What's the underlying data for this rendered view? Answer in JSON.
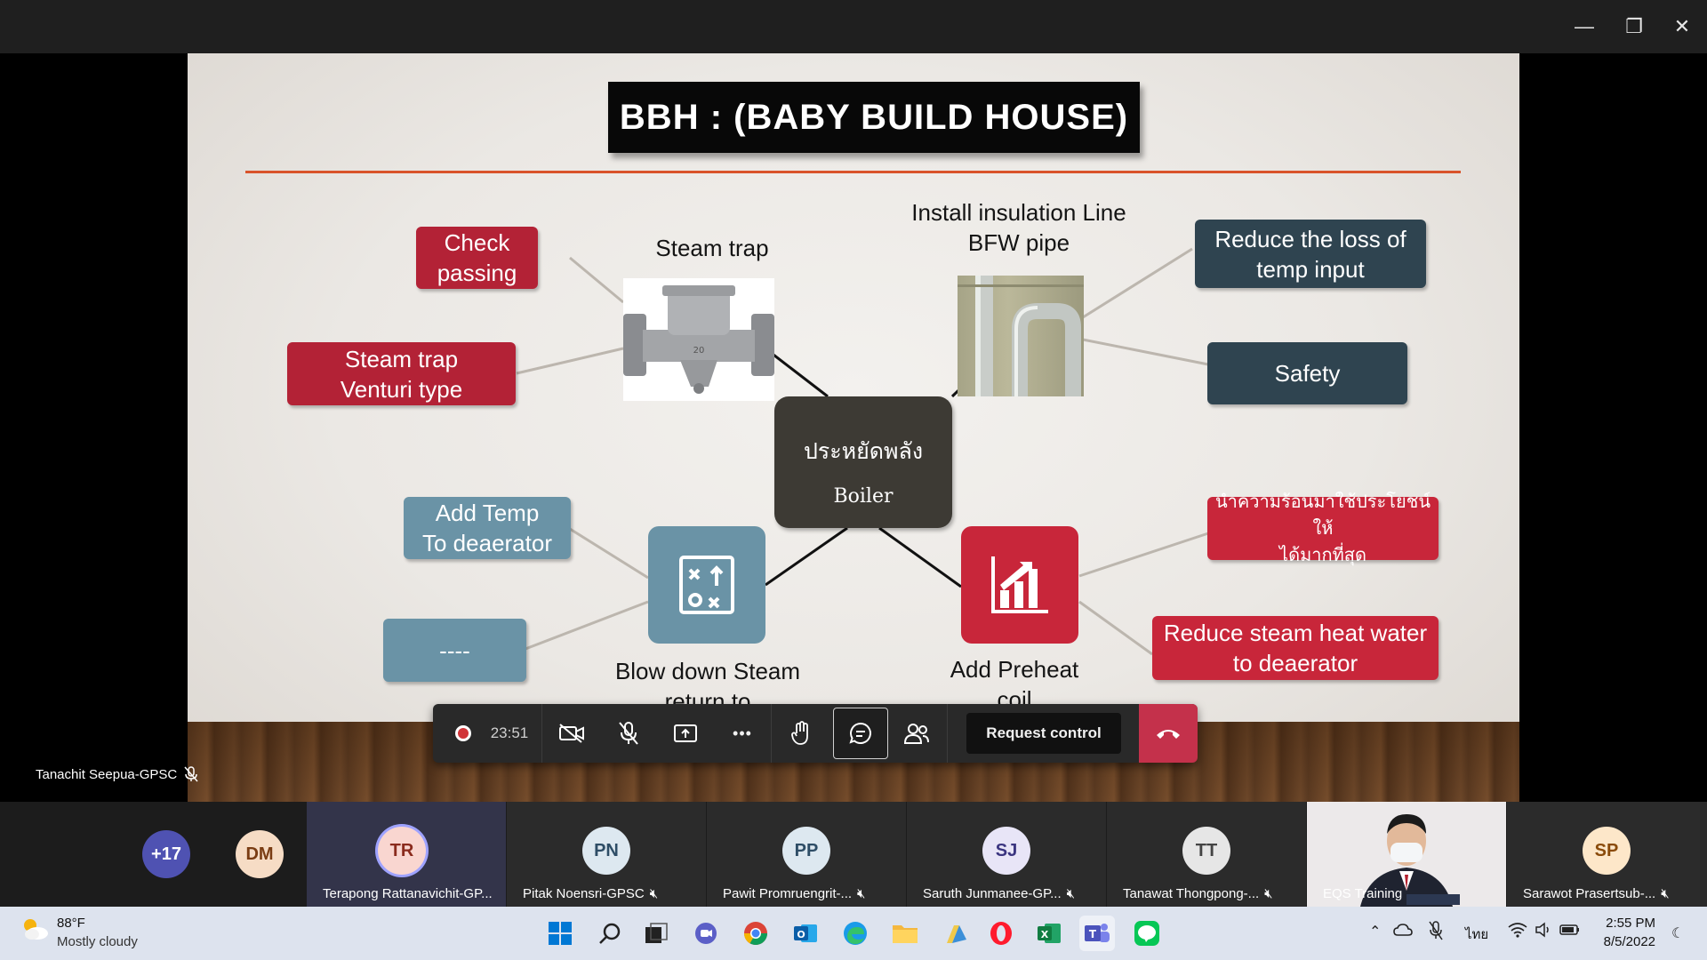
{
  "window": {
    "minimize": "—",
    "restore": "❐",
    "close": "✕"
  },
  "slide": {
    "title": "BBH : (BABY BUILD HOUSE)",
    "center": {
      "line1": "ประหยัดพลัง",
      "line2": "Boiler"
    },
    "top_left_label": "Steam trap",
    "top_right_label": "Install insulation Line\nBFW pipe",
    "bottom_left_label": "Blow down Steam\nreturn to",
    "bottom_right_label": "Add Preheat\ncoil",
    "boxes": {
      "check_passing": "Check\npassing",
      "steam_trap_venturi": "Steam trap\nVenturi type",
      "reduce_loss": "Reduce the loss of\ntemp input",
      "safety": "Safety",
      "add_temp": "Add Temp\nTo deaerator",
      "dashes": "----",
      "thai_heat": "นำความร้อนมาใช้ประโยชน์ให้\nได้มากที่สุด",
      "reduce_steam": "Reduce steam heat water\nto deaerator"
    },
    "colors": {
      "red": "#b32236",
      "dark": "#2f4450",
      "blue": "#6a93a6",
      "accent_rule": "#d9532a"
    }
  },
  "toolbar": {
    "timer": "23:51",
    "request_control": "Request control",
    "more": "•••"
  },
  "speaker": {
    "name": "Tanachit Seepua-GPSC"
  },
  "participants": {
    "overflow": "+17",
    "dm": "DM",
    "tiles": [
      {
        "initials": "TR",
        "name": "Terapong Rattanavichit-GP..."
      },
      {
        "initials": "PN",
        "name": "Pitak Noensri-GPSC"
      },
      {
        "initials": "PP",
        "name": "Pawit Promruengrit-..."
      },
      {
        "initials": "SJ",
        "name": "Saruth Junmanee-GP..."
      },
      {
        "initials": "TT",
        "name": "Tanawat Thongpong-..."
      },
      {
        "initials": "",
        "name": "EQS Training"
      },
      {
        "initials": "SP",
        "name": "Sarawot Prasertsub-..."
      }
    ]
  },
  "taskbar": {
    "weather_temp": "88°F",
    "weather_desc": "Mostly cloudy",
    "lang": "ไทย",
    "time": "2:55 PM",
    "date": "8/5/2022"
  }
}
